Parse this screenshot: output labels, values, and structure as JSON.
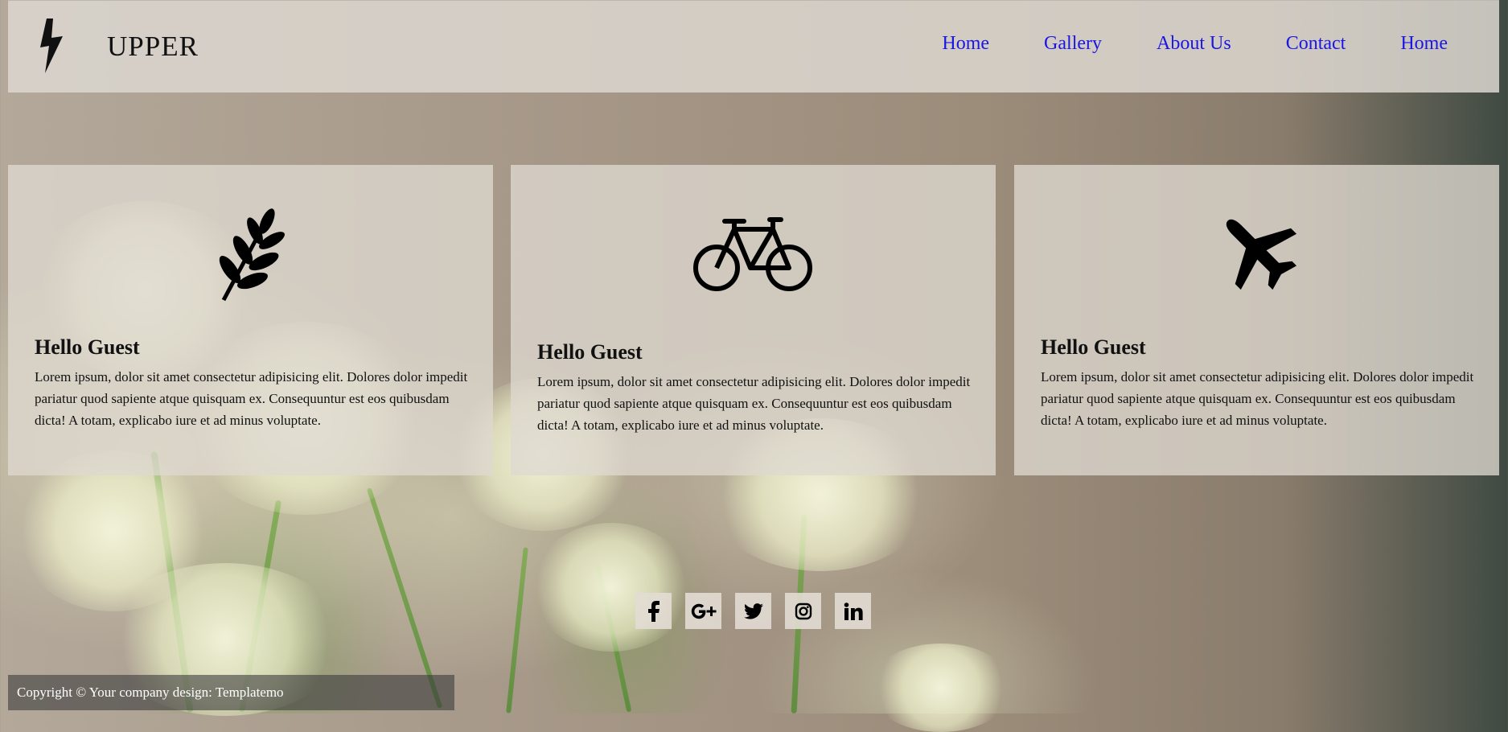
{
  "brand": {
    "name": "UPPER",
    "logo_icon": "lightning-bolt-icon"
  },
  "nav": {
    "items": [
      "Home",
      "Gallery",
      "About Us",
      "Contact",
      "Home"
    ],
    "link_color": "#1a16e6"
  },
  "cards": [
    {
      "icon": "leaf-icon",
      "title": "Hello Guest",
      "text": "Lorem ipsum, dolor sit amet consectetur adipisicing elit. Dolores dolor impedit pariatur quod sapiente atque quisquam ex. Consequuntur est eos quibusdam dicta! A totam, explicabo iure et ad minus voluptate."
    },
    {
      "icon": "bicycle-icon",
      "title": "Hello Guest",
      "text": "Lorem ipsum, dolor sit amet consectetur adipisicing elit. Dolores dolor impedit pariatur quod sapiente atque quisquam ex. Consequuntur est eos quibusdam dicta! A totam, explicabo iure et ad minus voluptate."
    },
    {
      "icon": "airplane-icon",
      "title": "Hello Guest",
      "text": "Lorem ipsum, dolor sit amet consectetur adipisicing elit. Dolores dolor impedit pariatur quod sapiente atque quisquam ex. Consequuntur est eos quibusdam dicta! A totam, explicabo iure et ad minus voluptate."
    }
  ],
  "social": [
    "facebook-icon",
    "google-plus-icon",
    "twitter-icon",
    "instagram-icon",
    "linkedin-icon"
  ],
  "footer": {
    "text": "Copyright © Your company design: Templatemo"
  }
}
